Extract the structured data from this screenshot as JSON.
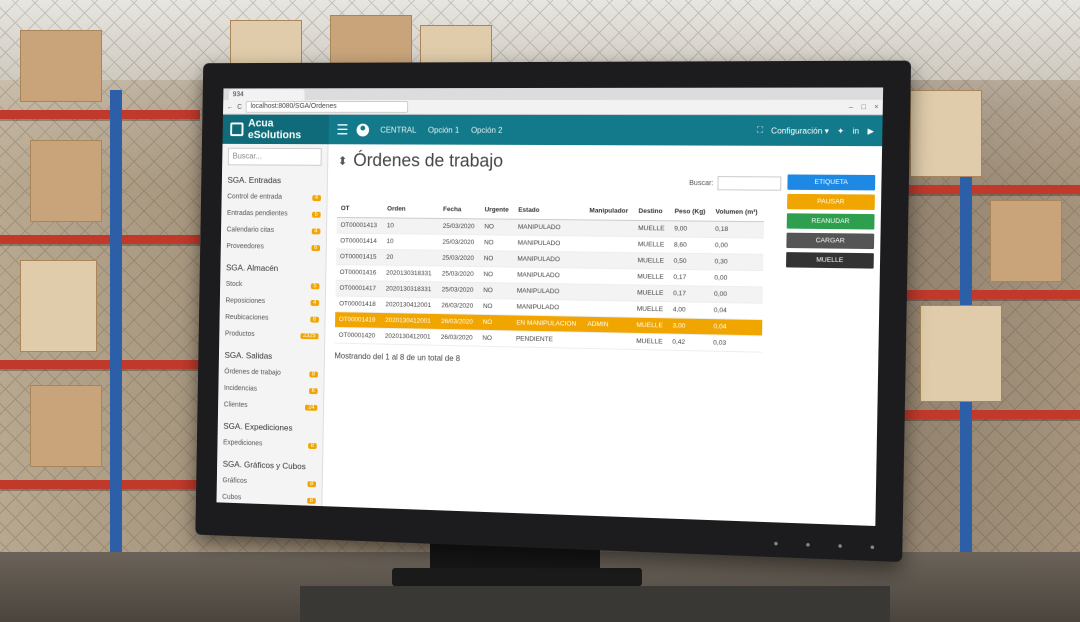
{
  "browser": {
    "tab_title": "934",
    "url": "localhost:8080/SGA/Ordenes"
  },
  "header": {
    "brand": "Acua eSolutions",
    "nav": [
      "CENTRAL",
      "Opción 1",
      "Opción 2"
    ],
    "config_label": "Configuración ▾",
    "accent_color": "#127a8a"
  },
  "sidebar": {
    "search_placeholder": "Buscar...",
    "sections": [
      {
        "title": "SGA. Entradas",
        "items": [
          {
            "label": "Control de entrada",
            "count": "4"
          },
          {
            "label": "Entradas pendientes",
            "count": "5"
          },
          {
            "label": "Calendario citas",
            "count": "4"
          },
          {
            "label": "Proveedores",
            "count": "6"
          }
        ]
      },
      {
        "title": "SGA. Almacén",
        "items": [
          {
            "label": "Stock",
            "count": "5"
          },
          {
            "label": "Reposiciones",
            "count": "4"
          },
          {
            "label": "Reubicaciones",
            "count": "8"
          },
          {
            "label": "Productos",
            "count": "2325"
          }
        ]
      },
      {
        "title": "SGA. Salidas",
        "items": [
          {
            "label": "Órdenes de trabajo",
            "count": "8"
          },
          {
            "label": "Incidencias",
            "count": "6"
          },
          {
            "label": "Clientes",
            "count": "24"
          }
        ]
      },
      {
        "title": "SGA. Expediciones",
        "items": [
          {
            "label": "Expediciones",
            "count": "8"
          }
        ]
      },
      {
        "title": "SGA. Gráficos y Cubos",
        "items": [
          {
            "label": "Gráficos",
            "count": "8"
          },
          {
            "label": "Cubos",
            "count": "8"
          }
        ]
      }
    ]
  },
  "main": {
    "title": "Órdenes de trabajo",
    "search_label": "Buscar:",
    "columns": [
      "OT",
      "Orden",
      "Fecha",
      "Urgente",
      "Estado",
      "Manipulador",
      "Destino",
      "Peso (Kg)",
      "Volumen (m³)"
    ],
    "rows": [
      [
        "OT00001413",
        "10",
        "25/03/2020",
        "NO",
        "MANIPULADO",
        "",
        "MUELLE",
        "9,00",
        "0,18"
      ],
      [
        "OT00001414",
        "10",
        "25/03/2020",
        "NO",
        "MANIPULADO",
        "",
        "MUELLE",
        "8,60",
        "0,00"
      ],
      [
        "OT00001415",
        "20",
        "25/03/2020",
        "NO",
        "MANIPULADO",
        "",
        "MUELLE",
        "0,50",
        "0,30"
      ],
      [
        "OT00001416",
        "2020130318331",
        "25/03/2020",
        "NO",
        "MANIPULADO",
        "",
        "MUELLE",
        "0,17",
        "0,00"
      ],
      [
        "OT00001417",
        "2020130318331",
        "25/03/2020",
        "NO",
        "MANIPULADO",
        "",
        "MUELLE",
        "0,17",
        "0,00"
      ],
      [
        "OT00001418",
        "2020130412001",
        "26/03/2020",
        "NO",
        "MANIPULADO",
        "",
        "MUELLE",
        "4,00",
        "0,04"
      ],
      [
        "OT00001419",
        "2020130412001",
        "26/03/2020",
        "NO",
        "EN MANIPULACION",
        "ADMIN",
        "MUELLE",
        "3,00",
        "0,04"
      ],
      [
        "OT00001420",
        "2020130412001",
        "26/03/2020",
        "NO",
        "PENDIENTE",
        "",
        "MUELLE",
        "0,42",
        "0,03"
      ]
    ],
    "selected_row": 6,
    "footer": "Mostrando del 1 al 8 de un total de 8"
  },
  "actions": [
    {
      "label": "ETIQUETA",
      "color": "#1e88e5"
    },
    {
      "label": "PAUSAR",
      "color": "#f0a500"
    },
    {
      "label": "REANUDAR",
      "color": "#2e9e4f"
    },
    {
      "label": "CARGAR",
      "color": "#555555"
    },
    {
      "label": "MUELLE",
      "color": "#333333"
    }
  ]
}
